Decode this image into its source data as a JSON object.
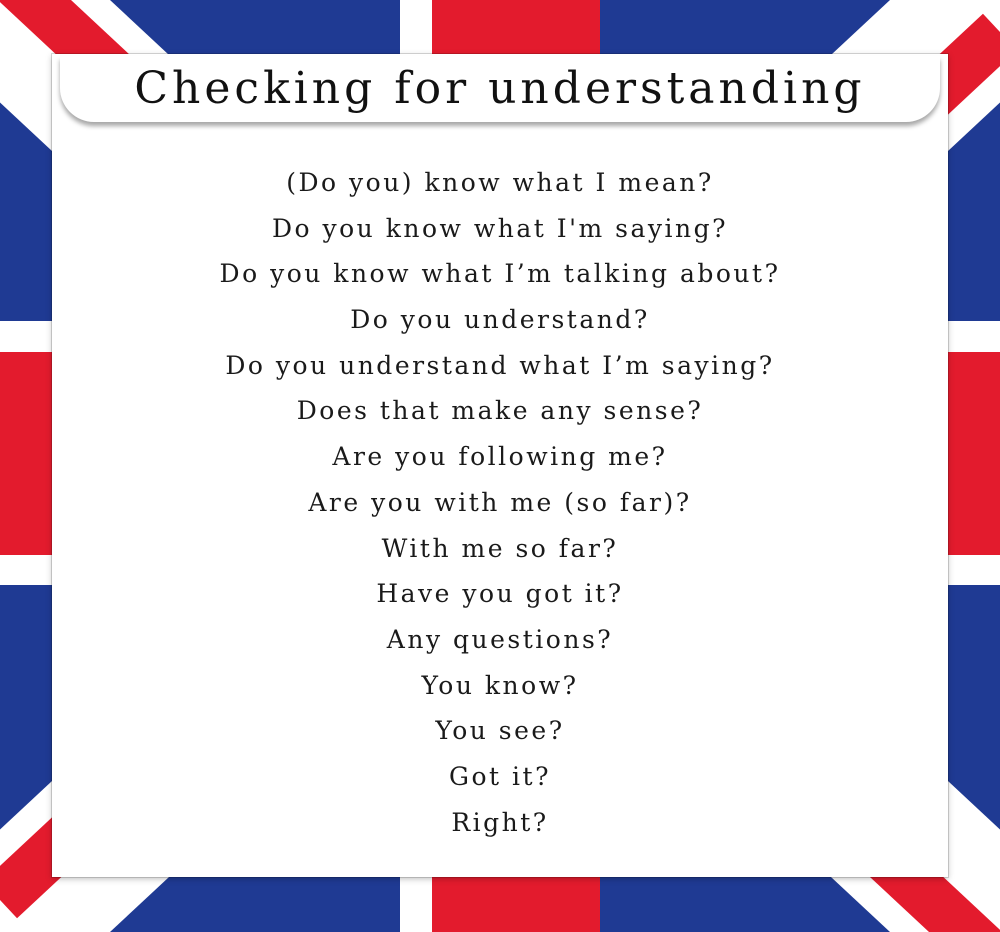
{
  "title": "Checking for understanding",
  "phrases": [
    "(Do you) know what I mean?",
    "Do you know what I'm saying?",
    "Do you know what I’m talking about?",
    "Do you understand?",
    "Do you understand what I’m saying?",
    "Does that make any sense?",
    "Are you following me?",
    "Are you with me (so far)?",
    "With me so far?",
    "Have you got it?",
    "Any questions?",
    "You know?",
    "You see?",
    "Got it?",
    "Right?"
  ],
  "colors": {
    "flag_blue": "#1f3a93",
    "flag_red": "#e31b2d",
    "flag_white": "#ffffff",
    "text": "#1a1a1a"
  }
}
